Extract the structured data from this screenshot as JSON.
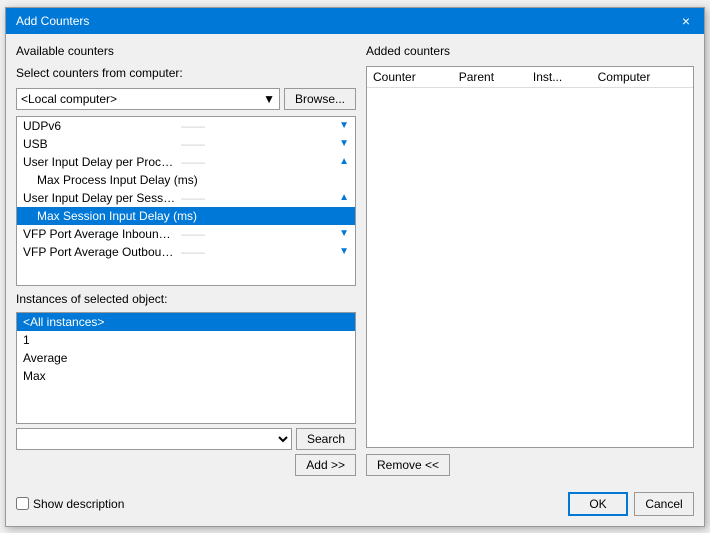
{
  "dialog": {
    "title": "Add Counters",
    "close_label": "×"
  },
  "left": {
    "available_counters_label": "Available counters",
    "select_computer_label": "Select counters from computer:",
    "computer_value": "<Local computer>",
    "browse_label": "Browse...",
    "counters": [
      {
        "id": "udpv6",
        "label": "UDPv6",
        "indent": false,
        "has_expand": true,
        "expand_dir": "down",
        "selected": false
      },
      {
        "id": "usb",
        "label": "USB",
        "indent": false,
        "has_expand": true,
        "expand_dir": "down",
        "selected": false
      },
      {
        "id": "user_input_delay_process",
        "label": "User Input Delay per Process",
        "indent": false,
        "has_expand": true,
        "expand_dir": "up",
        "selected": false
      },
      {
        "id": "max_process_input_delay",
        "label": "Max Process Input Delay (ms)",
        "indent": true,
        "has_expand": false,
        "selected": false
      },
      {
        "id": "user_input_delay_session",
        "label": "User Input Delay per Session",
        "indent": false,
        "has_expand": true,
        "expand_dir": "up",
        "selected": false
      },
      {
        "id": "max_session_input_delay",
        "label": "Max Session Input Delay (ms)",
        "indent": true,
        "has_expand": false,
        "selected": true
      },
      {
        "id": "vfp_inbound",
        "label": "VFP Port Average Inbound Network Traffic",
        "indent": false,
        "has_expand": true,
        "expand_dir": "down",
        "selected": false
      },
      {
        "id": "vfp_outbound",
        "label": "VFP Port Average Outbound Network Traffic",
        "indent": false,
        "has_expand": true,
        "expand_dir": "down",
        "selected": false
      }
    ],
    "instances_label": "Instances of selected object:",
    "instances": [
      {
        "id": "all",
        "label": "<All instances>",
        "selected": true
      },
      {
        "id": "inst1",
        "label": "1",
        "selected": false
      },
      {
        "id": "average",
        "label": "Average",
        "selected": false
      },
      {
        "id": "max",
        "label": "Max",
        "selected": false
      }
    ],
    "search_placeholder": "",
    "search_label": "Search",
    "add_label": "Add >>"
  },
  "right": {
    "added_counters_label": "Added counters",
    "columns": [
      "Counter",
      "Parent",
      "Inst...",
      "Computer"
    ],
    "rows": [],
    "remove_label": "Remove <<"
  },
  "footer": {
    "show_description_label": "Show description",
    "ok_label": "OK",
    "cancel_label": "Cancel"
  }
}
